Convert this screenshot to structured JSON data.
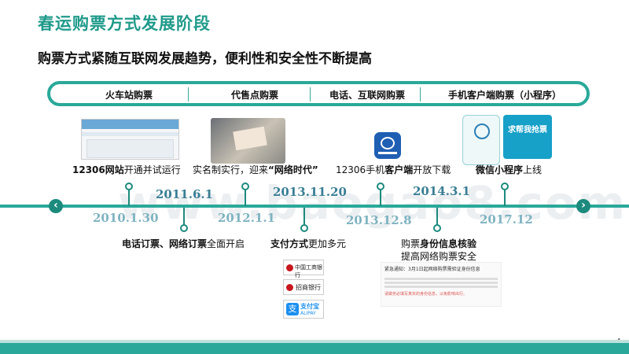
{
  "title": "春运购票方式发展阶段",
  "subtitle": "购票方式紧随互联网发展趋势，便利性和安全性不断提高",
  "stages": [
    {
      "label": "火车站购票"
    },
    {
      "label": "代售点购票"
    },
    {
      "label": "电话、互联网购票"
    },
    {
      "label": "手机客户端购票（小程序）"
    }
  ],
  "years": {
    "y2010": "2010.1.30",
    "y2011": "2011.6.1",
    "y2012": "2012.1.1",
    "y2013a": "2013.11.20",
    "y2013b": "2013.12.8",
    "y2014": "2014.3.1",
    "y2017": "2017.12"
  },
  "events": {
    "e1_bold": "12306网站",
    "e1_rest": "开通并试运行",
    "e2_a": "实名制实行，迎来",
    "e2_bold": "“网络时代”",
    "e3_a": "12306手机",
    "e3_bold": "客户端",
    "e3_rest": "开放下载",
    "e4_bold": "微信小程序",
    "e4_rest": "上线",
    "e5_bold": "电话订票、网络订票",
    "e5_rest": "全面开启",
    "e6_bold": "支付方式",
    "e6_rest": "更加多元",
    "e7_a": "购票",
    "e7_bold": "身份信息核验",
    "e7_line2": "提高网络购票安全"
  },
  "images": {
    "bank1": "中国工商银行",
    "bank2": "招商银行",
    "alipay": "支付宝",
    "alipay_en": "ALIPAY",
    "wechat_title": "求帮我抢票",
    "notice_title": "紧急通知：3月1日起网络购票需验证身份信息",
    "notice_red": "请做务必填写真实的身份信息，以免影响出行。"
  },
  "watermark": "www.baogao8.com",
  "page_number": "4",
  "colors": {
    "accent": "#2aa99a",
    "year": "#3a7e95",
    "title": "#1f9a8a"
  }
}
